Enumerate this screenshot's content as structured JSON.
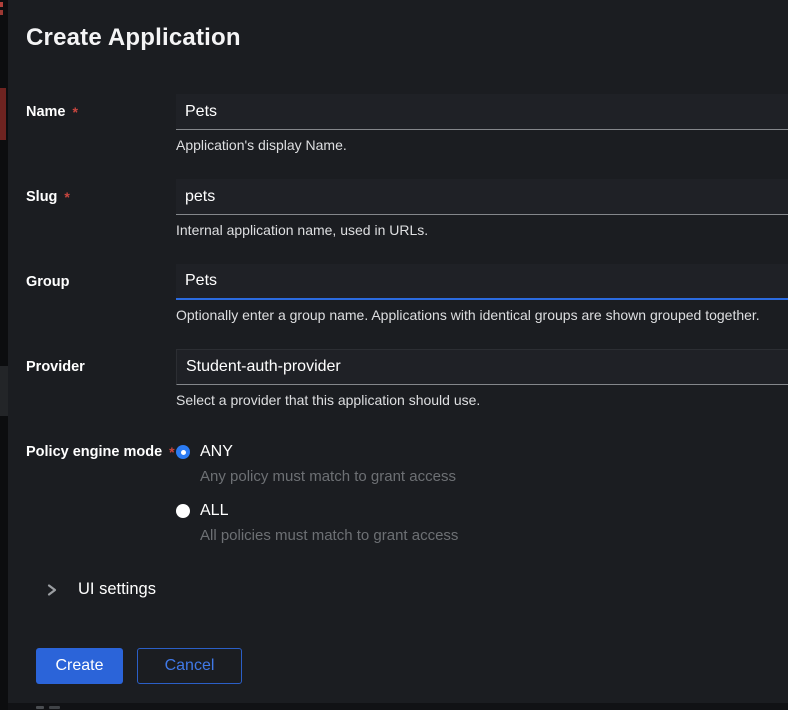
{
  "modal": {
    "title": "Create Application"
  },
  "form": {
    "required_marker": "*",
    "fields": [
      {
        "label": "Name",
        "value": "Pets",
        "help": "Application's display Name."
      },
      {
        "label": "Slug",
        "value": "pets",
        "help": "Internal application name, used in URLs."
      },
      {
        "label": "Group",
        "value": "Pets",
        "help": "Optionally enter a group name. Applications with identical groups are shown grouped together."
      },
      {
        "label": "Provider",
        "value": "Student-auth-provider",
        "help": "Select a provider that this application should use."
      }
    ],
    "policy_engine_mode": {
      "label": "Policy engine mode",
      "options": [
        {
          "label": "ANY",
          "help": "Any policy must match to grant access"
        },
        {
          "label": "ALL",
          "help": "All policies must match to grant access"
        }
      ]
    },
    "ui_settings_label": "UI settings"
  },
  "footer": {
    "create_label": "Create",
    "cancel_label": "Cancel"
  },
  "colors": {
    "accent_blue": "#2b64d9",
    "focus_underline": "#2b6be0",
    "danger_red": "#c9463f",
    "modal_background": "#1b1d21"
  }
}
